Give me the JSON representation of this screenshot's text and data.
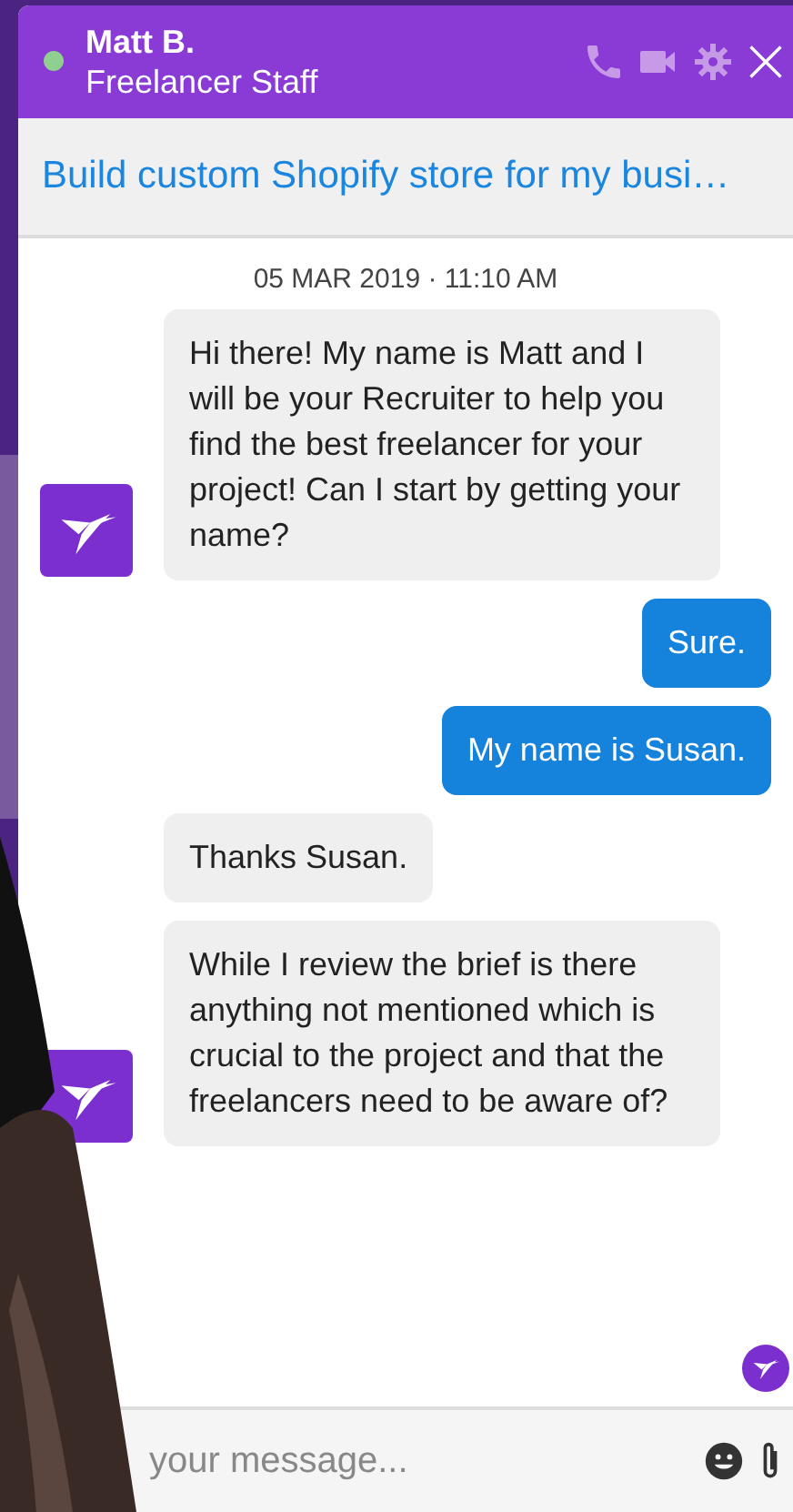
{
  "header": {
    "name": "Matt B.",
    "role": "Freelancer Staff",
    "online": true
  },
  "project_title": "Build custom Shopify store for my busi…",
  "timestamp": "05 MAR 2019 · 11:10 AM",
  "messages": [
    {
      "kind": "agent",
      "text": "Hi there! My name is Matt and I will be your Recruiter to help you find the best freelancer for your project! Can I start by getting your name?",
      "avatar": true
    },
    {
      "kind": "user",
      "text": "Sure."
    },
    {
      "kind": "user",
      "text": "My name is Susan."
    },
    {
      "kind": "agent",
      "text": "Thanks Susan.",
      "avatar": false
    },
    {
      "kind": "agent",
      "text": "While I review the brief is there anything not mentioned which is crucial to the project and that the freelancers need to be aware of?",
      "avatar": true
    }
  ],
  "input": {
    "placeholder": "your message..."
  }
}
